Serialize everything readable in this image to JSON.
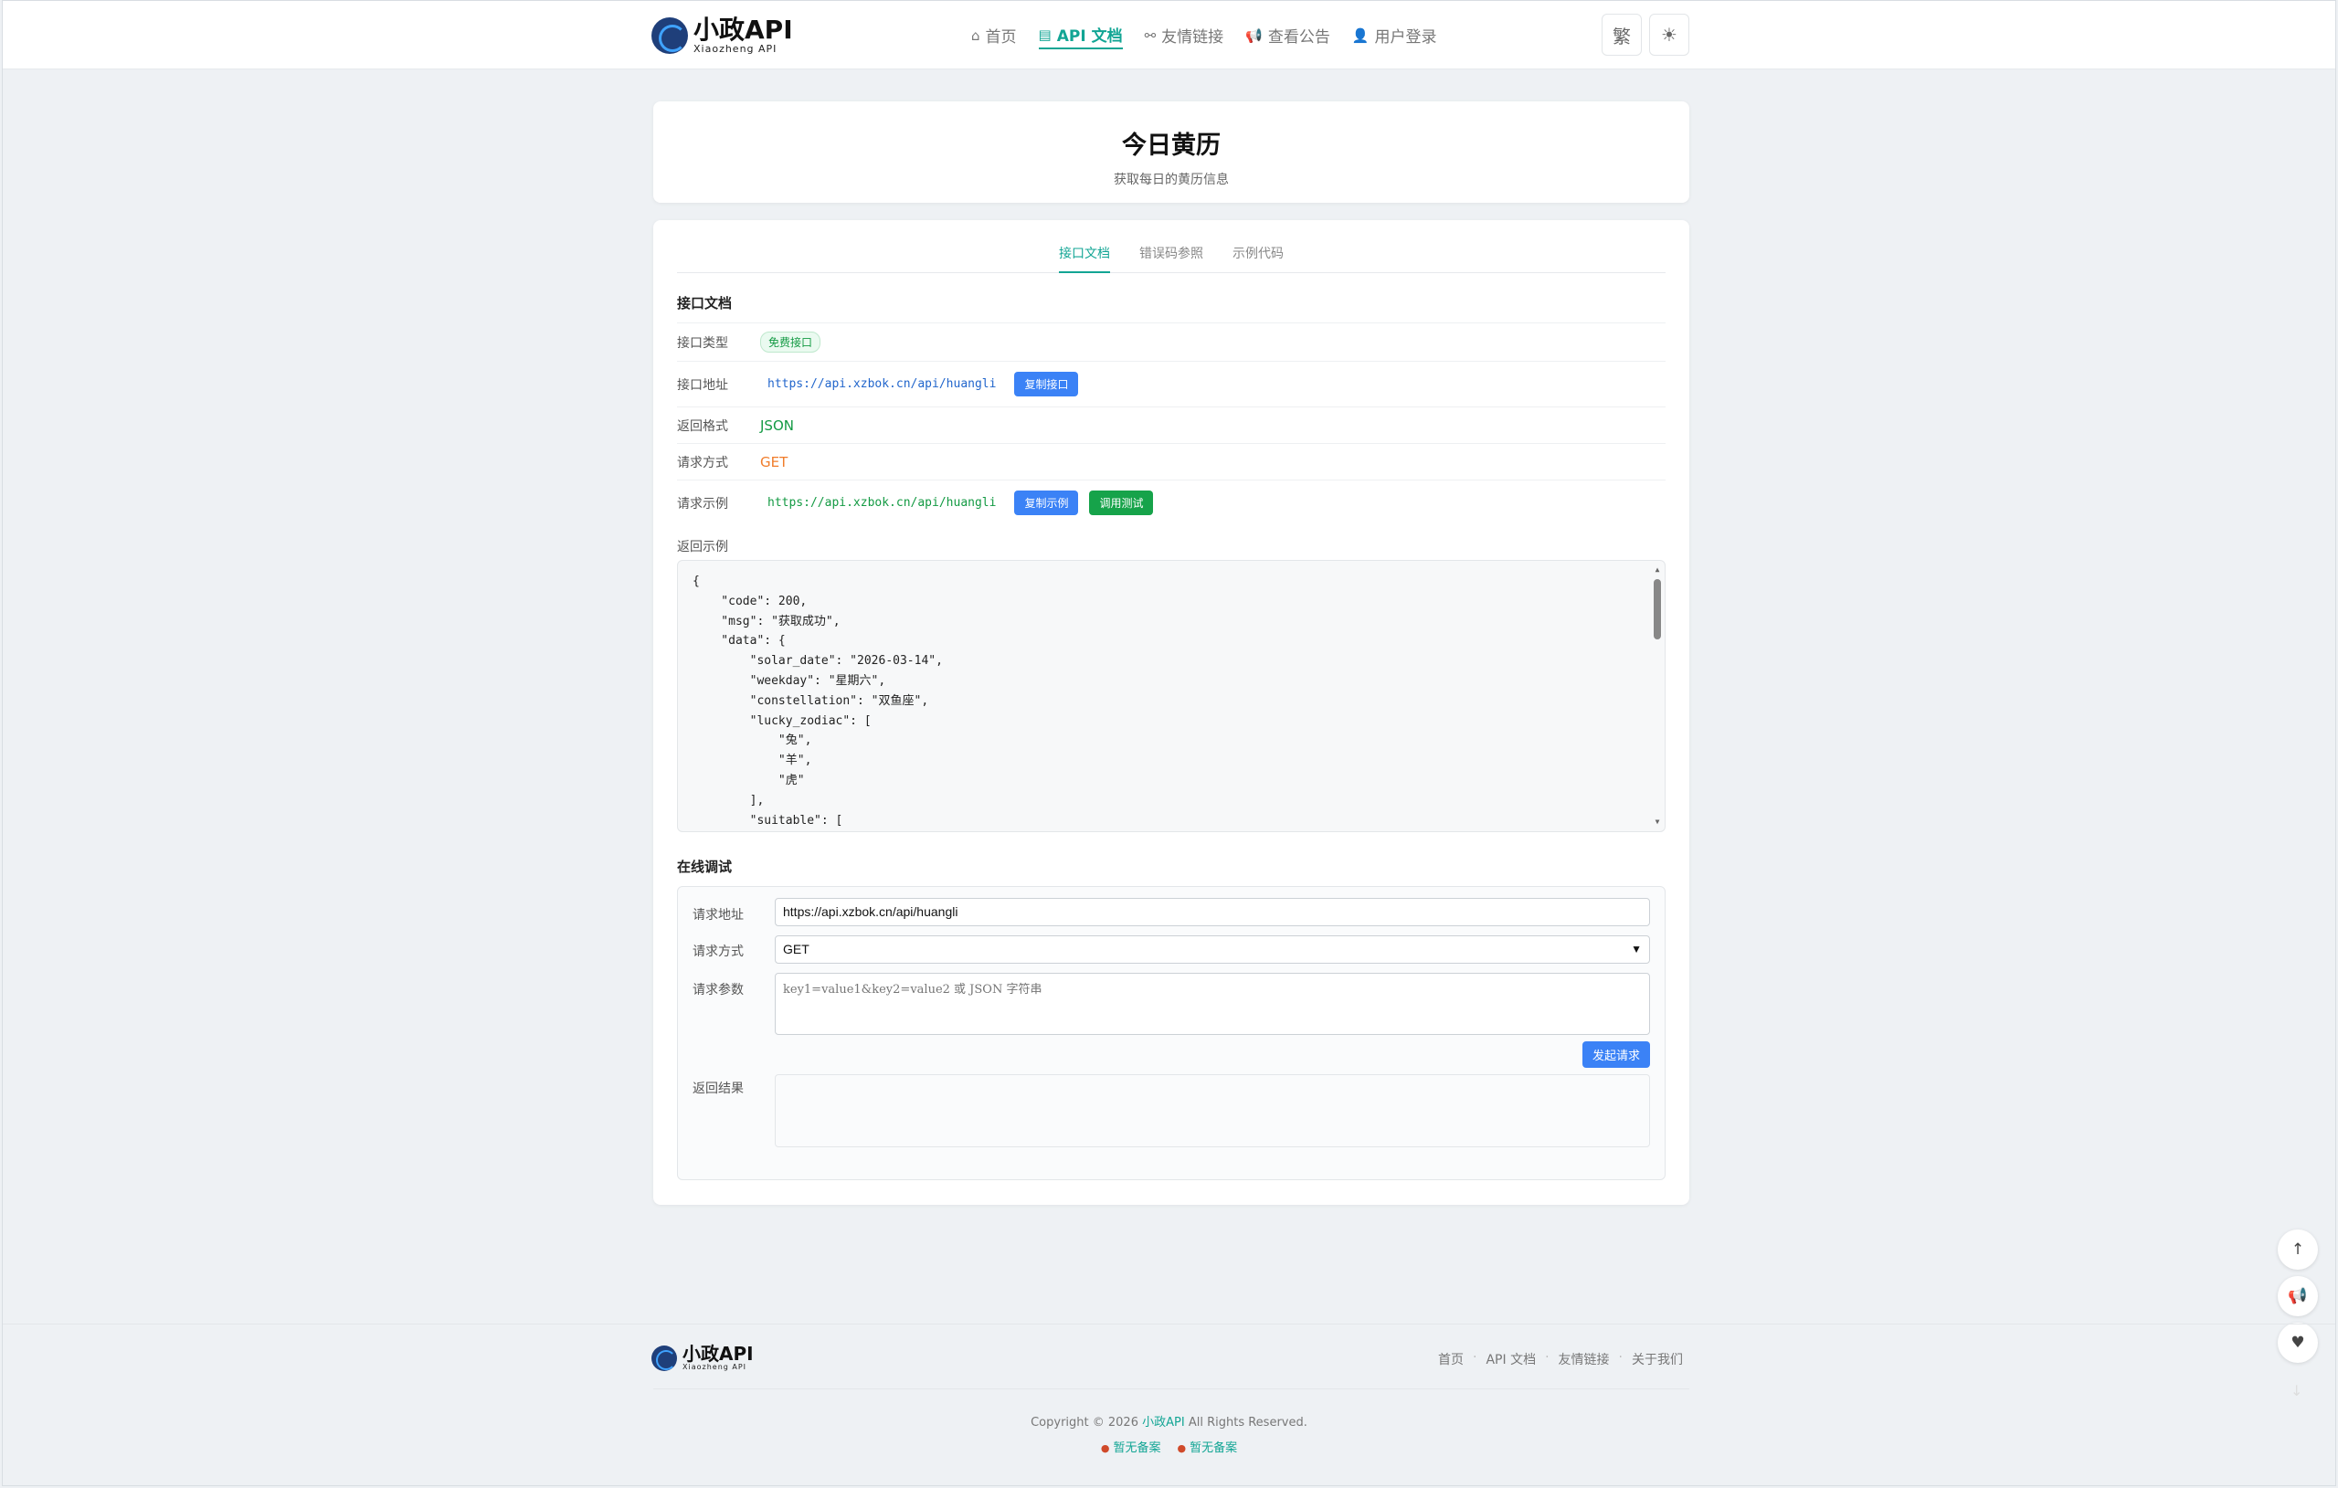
{
  "header": {
    "logo_title": "小政API",
    "logo_sub": "Xiaozheng API",
    "nav": [
      {
        "icon": "⌂",
        "label": "首页"
      },
      {
        "icon": "▤",
        "label": "API 文档"
      },
      {
        "icon": "⚯",
        "label": "友情链接"
      },
      {
        "icon": "📢",
        "label": "查看公告"
      },
      {
        "icon": "👤",
        "label": "用户登录"
      }
    ],
    "lang_button": "繁",
    "theme_button_icon": "☀"
  },
  "title_card": {
    "title": "今日黄历",
    "subtitle": "获取每日的黄历信息"
  },
  "tabs": [
    "接口文档",
    "错误码参照",
    "示例代码"
  ],
  "doc": {
    "section_title": "接口文档",
    "type_label": "接口类型",
    "type_badge": "免费接口",
    "url_label": "接口地址",
    "url": "https://api.xzbok.cn/api/huangli",
    "copy_url_button": "复制接口",
    "format_label": "返回格式",
    "format_value": "JSON",
    "method_label": "请求方式",
    "method_value": "GET",
    "example_label": "请求示例",
    "example_url": "https://api.xzbok.cn/api/huangli",
    "copy_example_button": "复制示例",
    "debug_button": "调用测试",
    "response_label": "返回示例",
    "response_lines": [
      "{",
      "    \"code\": 200,",
      "    \"msg\": \"获取成功\",",
      "    \"data\": {",
      "        \"solar_date\": \"2026-03-14\",",
      "        \"weekday\": \"星期六\",",
      "        \"constellation\": \"双鱼座\",",
      "        \"lucky_zodiac\": [",
      "            \"兔\",",
      "            \"羊\",",
      "            \"虎\"",
      "        ],",
      "        \"suitable\": ["
    ]
  },
  "debug": {
    "section_title": "在线调试",
    "url_label": "请求地址",
    "url_value": "https://api.xzbok.cn/api/huangli",
    "method_label": "请求方式",
    "method_value": "GET",
    "params_label": "请求参数",
    "params_placeholder": "key1=value1&key2=value2 或 JSON 字符串",
    "send_button": "发起请求",
    "result_label": "返回结果"
  },
  "footer": {
    "logo_title": "小政API",
    "logo_sub": "Xiaozheng API",
    "links": [
      "首页",
      "API 文档",
      "友情链接",
      "关于我们"
    ],
    "separator": "·",
    "copyright_prefix": "Copyright © 2026 ",
    "copyright_brand": "小政API",
    "copyright_suffix": " All Rights Reserved.",
    "beian": [
      "暂无备案",
      "暂无备案"
    ]
  },
  "colors": {
    "accent": "#12a594",
    "primary_button": "#3b82f6",
    "success_button": "#16a34a",
    "method_orange": "#f07c2a"
  }
}
